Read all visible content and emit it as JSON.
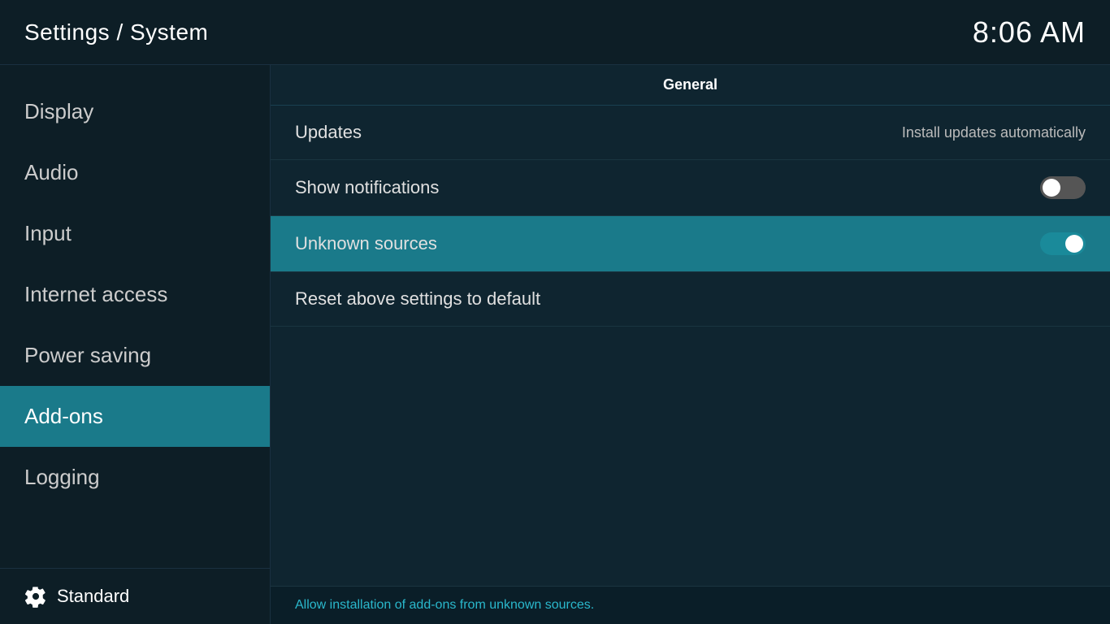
{
  "header": {
    "title": "Settings / System",
    "time": "8:06 AM"
  },
  "sidebar": {
    "items": [
      {
        "id": "display",
        "label": "Display",
        "active": false
      },
      {
        "id": "audio",
        "label": "Audio",
        "active": false
      },
      {
        "id": "input",
        "label": "Input",
        "active": false
      },
      {
        "id": "internet-access",
        "label": "Internet access",
        "active": false
      },
      {
        "id": "power-saving",
        "label": "Power saving",
        "active": false
      },
      {
        "id": "add-ons",
        "label": "Add-ons",
        "active": true
      },
      {
        "id": "logging",
        "label": "Logging",
        "active": false
      }
    ],
    "footer": {
      "label": "Standard",
      "icon": "gear"
    }
  },
  "content": {
    "section_title": "General",
    "settings": [
      {
        "id": "updates",
        "label": "Updates",
        "value_text": "Install updates automatically",
        "toggle": null
      },
      {
        "id": "show-notifications",
        "label": "Show notifications",
        "value_text": null,
        "toggle": "off"
      },
      {
        "id": "unknown-sources",
        "label": "Unknown sources",
        "value_text": null,
        "toggle": "on",
        "highlighted": true
      },
      {
        "id": "reset-settings",
        "label": "Reset above settings to default",
        "value_text": null,
        "toggle": null
      }
    ],
    "description": "Allow installation of add-ons from unknown sources."
  }
}
